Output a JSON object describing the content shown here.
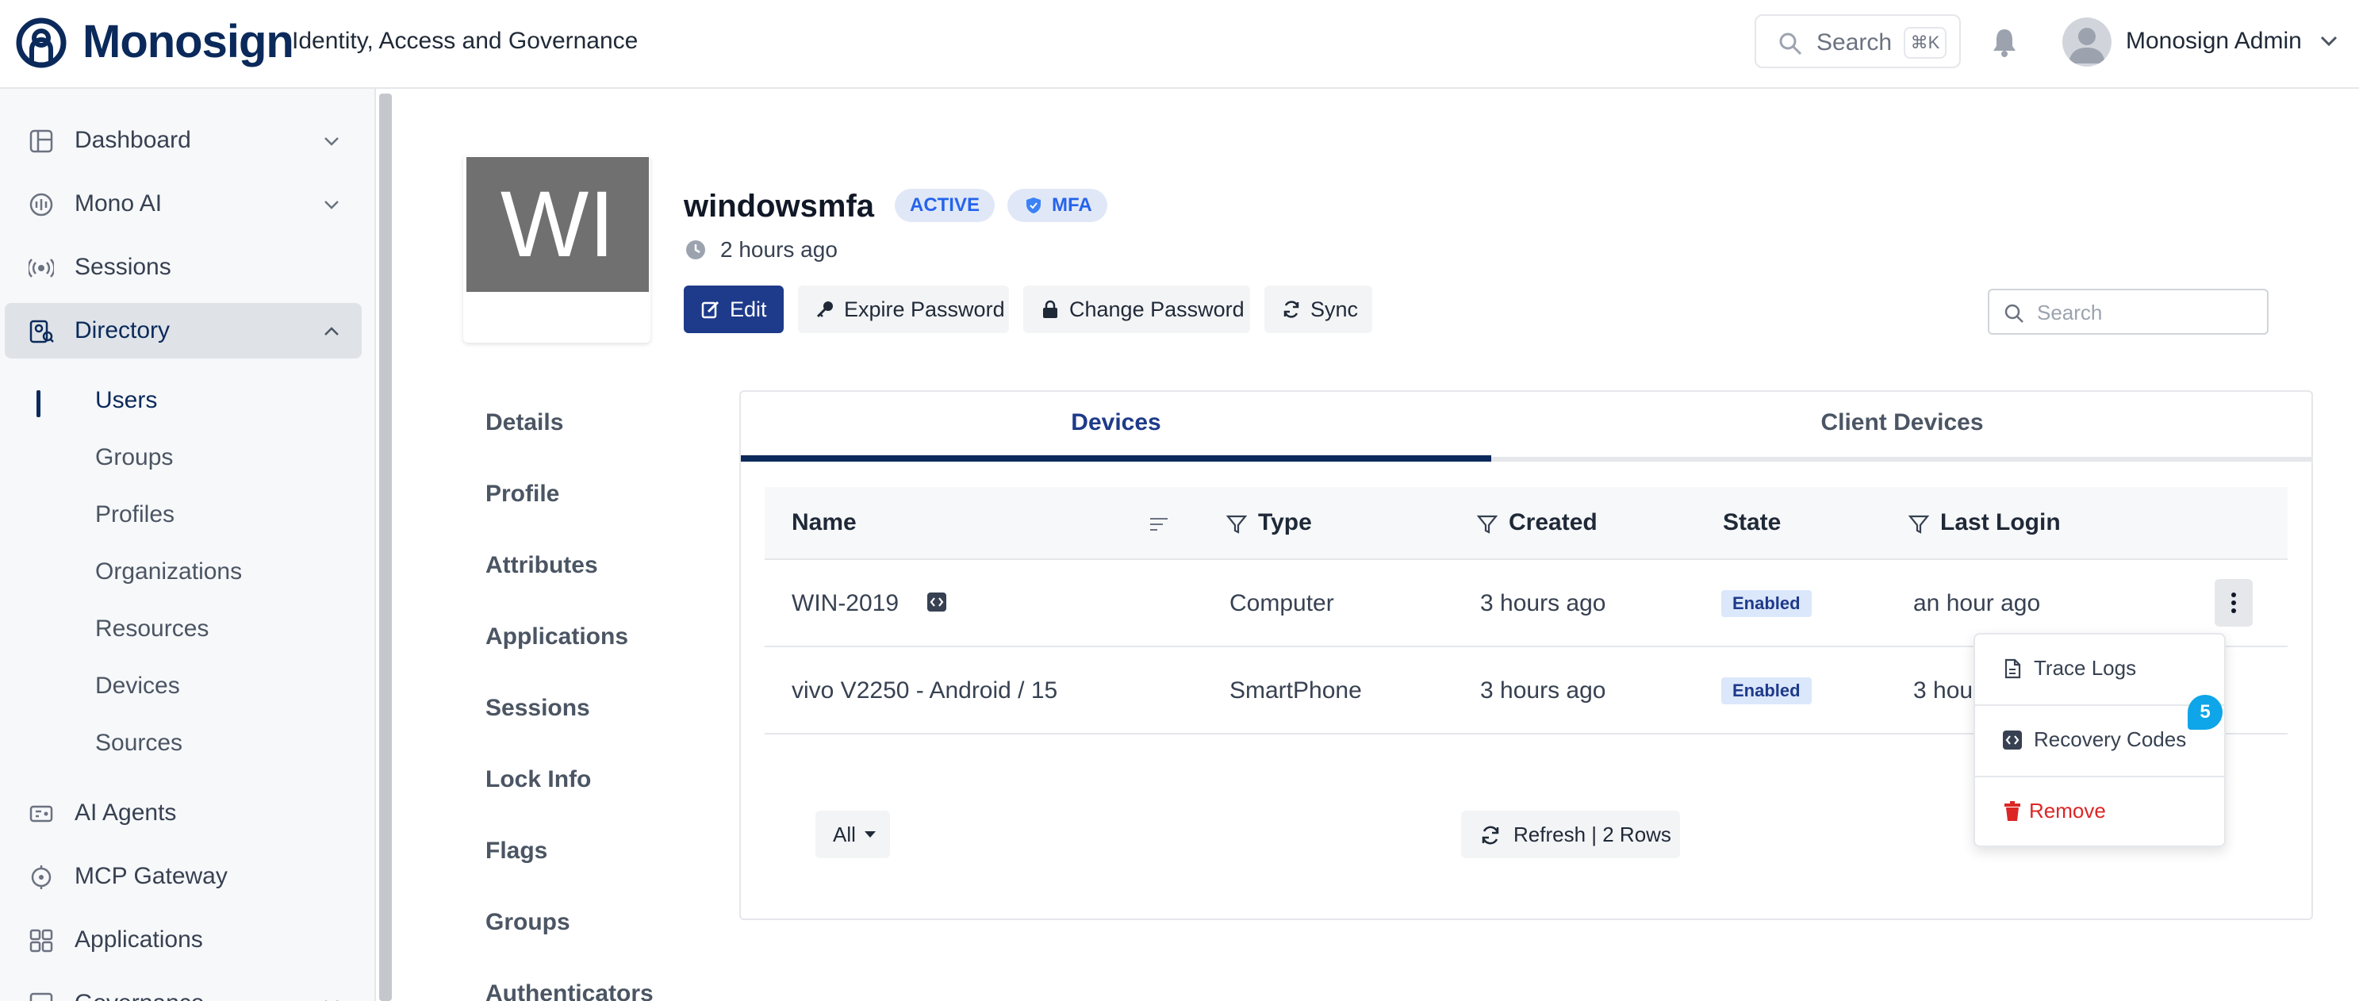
{
  "header": {
    "brand": "Monosign",
    "subtitle": "Identity, Access and Governance",
    "search_label": "Search",
    "search_shortcut": "⌘K",
    "user_name": "Monosign Admin"
  },
  "sidebar": {
    "items": [
      {
        "label": "Dashboard",
        "icon": "dashboard-icon",
        "has_chevron": true
      },
      {
        "label": "Mono AI",
        "icon": "mono-ai-icon",
        "has_chevron": true
      },
      {
        "label": "Sessions",
        "icon": "sessions-icon",
        "has_chevron": false
      },
      {
        "label": "Directory",
        "icon": "directory-icon",
        "has_chevron": true,
        "active": true
      },
      {
        "label": "AI Agents",
        "icon": "ai-agents-icon",
        "has_chevron": false
      },
      {
        "label": "MCP Gateway",
        "icon": "mcp-gateway-icon",
        "has_chevron": false
      },
      {
        "label": "Applications",
        "icon": "applications-icon",
        "has_chevron": false
      },
      {
        "label": "Governance",
        "icon": "governance-icon",
        "has_chevron": true
      }
    ],
    "directory_sub": [
      "Users",
      "Groups",
      "Profiles",
      "Organizations",
      "Resources",
      "Devices",
      "Sources"
    ],
    "current_sub": "Users"
  },
  "profile": {
    "initials": "WI",
    "name": "windowsmfa",
    "status_badge": "ACTIVE",
    "mfa_badge": "MFA",
    "time_ago": "2 hours ago",
    "actions": {
      "edit": "Edit",
      "expire_password": "Expire Password",
      "change_password": "Change Password",
      "sync": "Sync"
    },
    "search_placeholder": "Search",
    "sections": [
      "Details",
      "Profile",
      "Attributes",
      "Applications",
      "Sessions",
      "Lock Info",
      "Flags",
      "Groups",
      "Authenticators"
    ]
  },
  "devices": {
    "tabs": [
      "Devices",
      "Client Devices"
    ],
    "active_tab": "Devices",
    "columns": [
      "Name",
      "Type",
      "Created",
      "State",
      "Last Login"
    ],
    "rows": [
      {
        "name": "WIN-2019",
        "type": "Computer",
        "created": "3 hours ago",
        "state": "Enabled",
        "last_login": "an hour ago"
      },
      {
        "name": "vivo V2250 - Android / 15",
        "type": "SmartPhone",
        "created": "3 hours ago",
        "state": "Enabled",
        "last_login": "3 hou"
      }
    ],
    "filter_label": "All",
    "refresh_label": "Refresh | 2 Rows"
  },
  "row_menu": {
    "items": [
      "Trace Logs",
      "Recovery Codes",
      "Remove"
    ],
    "badge_count": "5"
  },
  "colors": {
    "brand": "#0b2a5b",
    "primary_button": "#1e3a8a",
    "badge_bg": "#e0e8f7",
    "danger": "#dc2626",
    "notification": "#0ea5e9"
  }
}
